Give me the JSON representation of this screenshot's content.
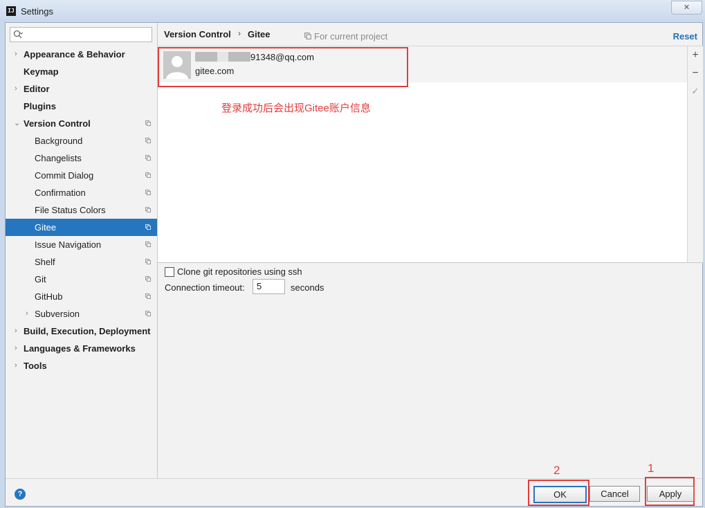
{
  "window": {
    "title": "Settings",
    "app_icon": "IJ",
    "close_glyph": "✕"
  },
  "sidebar": {
    "search_placeholder": "",
    "items": [
      {
        "label": "Appearance & Behavior"
      },
      {
        "label": "Keymap"
      },
      {
        "label": "Editor"
      },
      {
        "label": "Plugins"
      },
      {
        "label": "Version Control"
      },
      {
        "label": "Background"
      },
      {
        "label": "Changelists"
      },
      {
        "label": "Commit Dialog"
      },
      {
        "label": "Confirmation"
      },
      {
        "label": "File Status Colors"
      },
      {
        "label": "Gitee"
      },
      {
        "label": "Issue Navigation"
      },
      {
        "label": "Shelf"
      },
      {
        "label": "Git"
      },
      {
        "label": "GitHub"
      },
      {
        "label": "Subversion"
      },
      {
        "label": "Build, Execution, Deployment"
      },
      {
        "label": "Languages & Frameworks"
      },
      {
        "label": "Tools"
      }
    ],
    "selected": "Gitee"
  },
  "header": {
    "breadcrumb_parent": "Version Control",
    "breadcrumb_sep": "›",
    "breadcrumb_current": "Gitee",
    "scope_label": "For current project",
    "reset_label": "Reset"
  },
  "accounts": [
    {
      "email_suffix": "91348@qq.com",
      "server": "gitee.com"
    }
  ],
  "toolbar": {
    "add": "+",
    "remove": "−",
    "default": "✓"
  },
  "annotation": {
    "text": "登录成功后会出现Gitee账户信息",
    "num_ok": "2",
    "num_apply": "1"
  },
  "options": {
    "clone_ssh_label": "Clone git repositories using ssh",
    "clone_ssh_checked": false,
    "timeout_label": "Connection timeout:",
    "timeout_value": "5",
    "timeout_unit": "seconds"
  },
  "footer": {
    "help": "?",
    "ok": "OK",
    "cancel": "Cancel",
    "apply": "Apply"
  },
  "colors": {
    "accent": "#2675bf",
    "annotation": "#e23c3c",
    "selection": "#2675bf"
  }
}
